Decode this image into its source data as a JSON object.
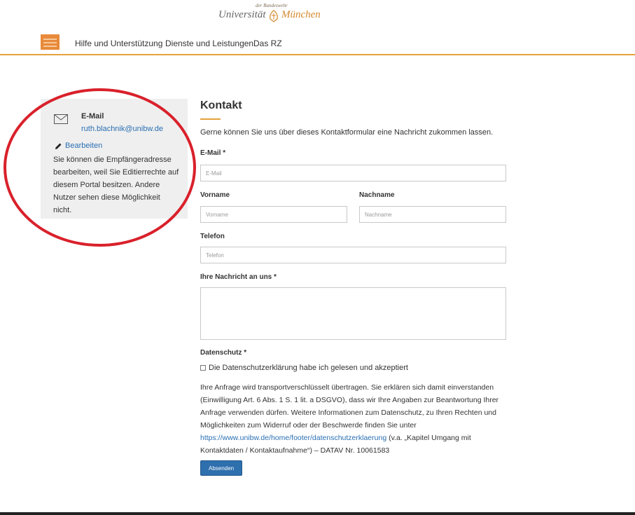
{
  "header": {
    "logo_small": "der Bundeswehr",
    "logo_university": "Universität",
    "logo_city": "München"
  },
  "nav": {
    "items": [
      "Hilfe und Unterstützung",
      "Dienste und Leistungen",
      "Das RZ"
    ]
  },
  "sidebar": {
    "email_label": "E-Mail",
    "email_value": "ruth.blachnik@unibw.de",
    "edit_label": "Bearbeiten",
    "note": "Sie können die Empfängeradresse bearbeiten, weil Sie Editierrechte auf diesem Portal besitzen. Andere Nutzer sehen diese Möglichkeit nicht."
  },
  "form": {
    "title": "Kontakt",
    "intro": "Gerne können Sie uns über dieses Kontaktformular eine Nachricht zukommen lassen.",
    "email": {
      "label": "E-Mail *",
      "placeholder": "E-Mail"
    },
    "firstname": {
      "label": "Vorname",
      "placeholder": "Vorname"
    },
    "lastname": {
      "label": "Nachname",
      "placeholder": "Nachname"
    },
    "phone": {
      "label": "Telefon",
      "placeholder": "Telefon"
    },
    "message": {
      "label": "Ihre Nachricht an uns *"
    },
    "privacy_label": "Datenschutz *",
    "privacy_check": "Die Datenschutzerklärung habe ich gelesen und akzeptiert",
    "legal_text_1": "Ihre Anfrage wird transportverschlüsselt übertragen. Sie erklären sich damit einverstanden (Einwilligung Art. 6 Abs. 1 S. 1 lit. a DSGVO), dass wir Ihre Angaben zur Beantwortung Ihrer Anfrage verwenden dürfen. Weitere Informationen zum Datenschutz, zu Ihren Rechten und Möglichkeiten zum Widerruf oder der Beschwerde finden Sie unter",
    "legal_link": "https://www.unibw.de/home/footer/datenschutzerklaerung",
    "legal_text_2": "(v.a. „Kapitel Umgang mit Kontaktdaten / Kontaktaufnahme“) – DATAV Nr. 10061583",
    "submit": "Absenden"
  },
  "colors": {
    "accent": "#e5a23d",
    "link": "#2a6fb3",
    "button": "#2e6fae",
    "annotation": "#d9212b"
  }
}
